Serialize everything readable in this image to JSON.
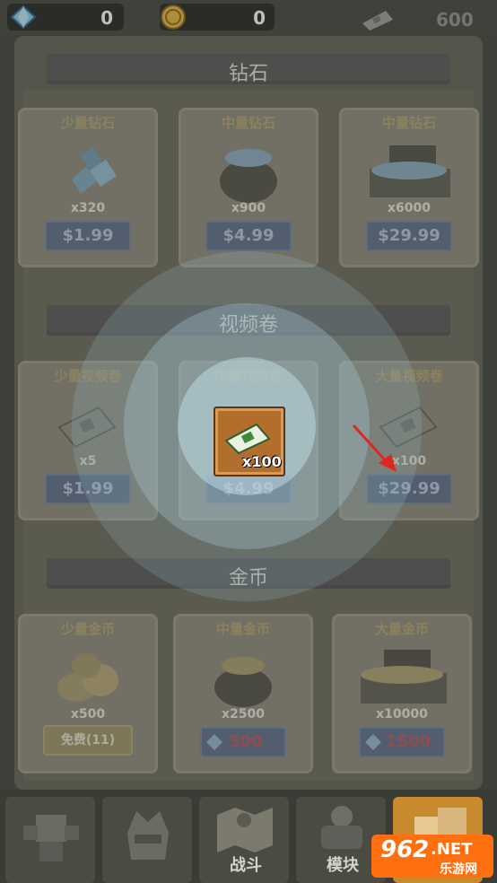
{
  "topbar": {
    "gem_count": "0",
    "coin_count": "0",
    "ticket_count": "600"
  },
  "sections": {
    "diamonds": {
      "title": "钻石",
      "items": [
        {
          "name": "少量钻石",
          "qty": "x320",
          "price": "$1.99"
        },
        {
          "name": "中量钻石",
          "qty": "x900",
          "price": "$4.99"
        },
        {
          "name": "中量钻石",
          "qty": "x6000",
          "price": "$29.99"
        }
      ]
    },
    "video": {
      "title": "视频卷",
      "items": [
        {
          "name": "少量视频卷",
          "qty": "x5",
          "price": "$1.99"
        },
        {
          "name": "中量视频卷",
          "qty": "x100",
          "price": "$4.99"
        },
        {
          "name": "大量视频卷",
          "qty": "x100",
          "price": "$29.99"
        }
      ]
    },
    "coins": {
      "title": "金币",
      "items": [
        {
          "name": "少量金币",
          "qty": "x500",
          "price": "免费(11)"
        },
        {
          "name": "中量金币",
          "qty": "x2500",
          "price": "500"
        },
        {
          "name": "大量金币",
          "qty": "x10000",
          "price": "1500"
        }
      ]
    }
  },
  "nav": {
    "battle": "战斗",
    "module": "模块"
  },
  "watermark": {
    "brand": "962",
    "domain": ".NET",
    "site": "乐游网"
  },
  "colors": {
    "accent_red": "#e0271f",
    "card_bg": "#8a8878",
    "price_btn": "#5a6c86"
  }
}
